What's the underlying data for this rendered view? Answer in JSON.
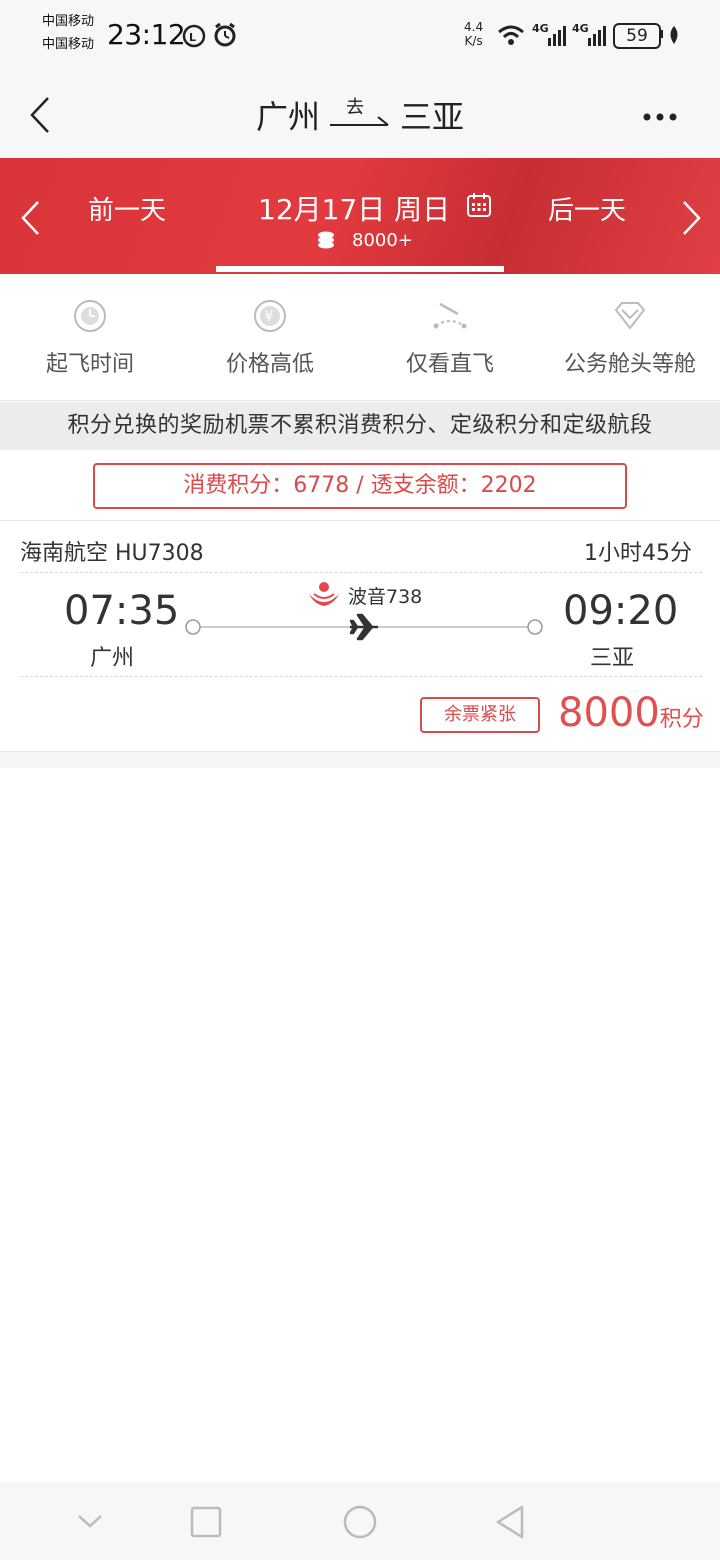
{
  "status_bar": {
    "carrier1": "中国移动",
    "carrier2": "中国移动",
    "time": "23:12",
    "net_speed_value": "4.4",
    "net_speed_unit": "K/s",
    "signal1": "4G",
    "signal2": "4G",
    "battery": "59"
  },
  "header": {
    "origin": "广州",
    "direction": "去",
    "destination": "三亚"
  },
  "date_bar": {
    "prev_label": "前一天",
    "date": "12月17日 周日",
    "points_min": "8000+",
    "next_label": "后一天"
  },
  "filters": [
    {
      "label": "起飞时间",
      "icon": "clock-icon"
    },
    {
      "label": "价格高低",
      "icon": "yuan-icon"
    },
    {
      "label": "仅看直飞",
      "icon": "direct-flight-icon"
    },
    {
      "label": "公务舱头等舱",
      "icon": "diamond-icon"
    }
  ],
  "notice": "积分兑换的奖励机票不累积消费积分、定级积分和定级航段",
  "points": {
    "text": "消费积分：6778 / 透支余额：2202"
  },
  "flight": {
    "airline": "海南航空 HU7308",
    "duration": "1小时45分",
    "aircraft": "波音738",
    "dep_time": "07:35",
    "dep_city": "广州",
    "arr_time": "09:20",
    "arr_city": "三亚",
    "seat_status": "余票紧张",
    "price": "8000",
    "price_unit": "积分"
  },
  "colors": {
    "brand_red": "#e03a3f",
    "accent_red": "#d94a4a"
  }
}
